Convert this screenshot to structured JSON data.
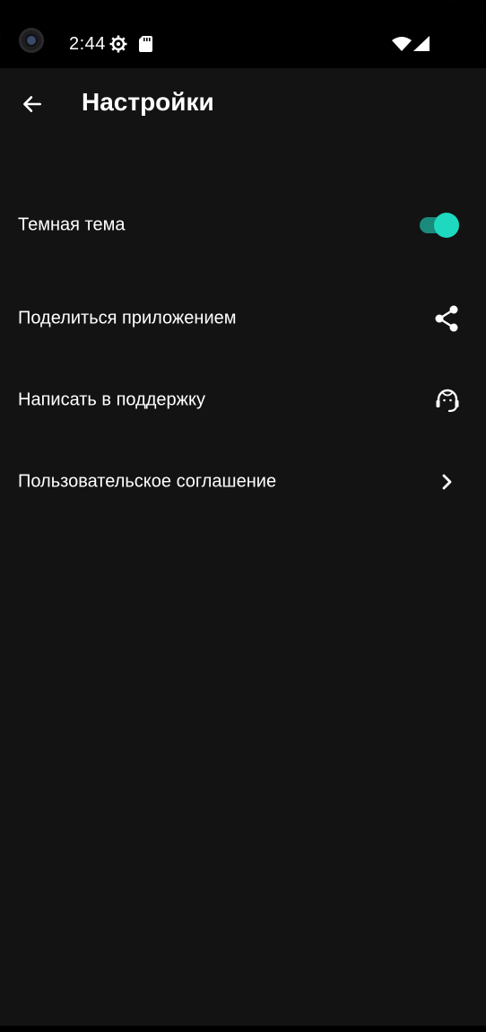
{
  "status_bar": {
    "time": "2:44",
    "icons": [
      "settings-gear-icon",
      "sd-card-icon",
      "wifi-icon",
      "cell-signal-icon"
    ]
  },
  "app_bar": {
    "back_icon": "arrow-back-icon",
    "title": "Настройки"
  },
  "settings": {
    "dark_theme": {
      "label": "Темная тема",
      "enabled": true
    },
    "share_app": {
      "label": "Поделиться приложением",
      "icon": "share-icon"
    },
    "support": {
      "label": "Написать в поддержку",
      "icon": "headset-support-icon"
    },
    "user_agreement": {
      "label": "Пользовательское соглашение",
      "icon": "chevron-right-icon"
    }
  },
  "colors": {
    "background": "#131313",
    "status_bar": "#000000",
    "accent": "#1ed8c0",
    "toggle_track": "#1a8a7a",
    "text": "#ffffff"
  }
}
